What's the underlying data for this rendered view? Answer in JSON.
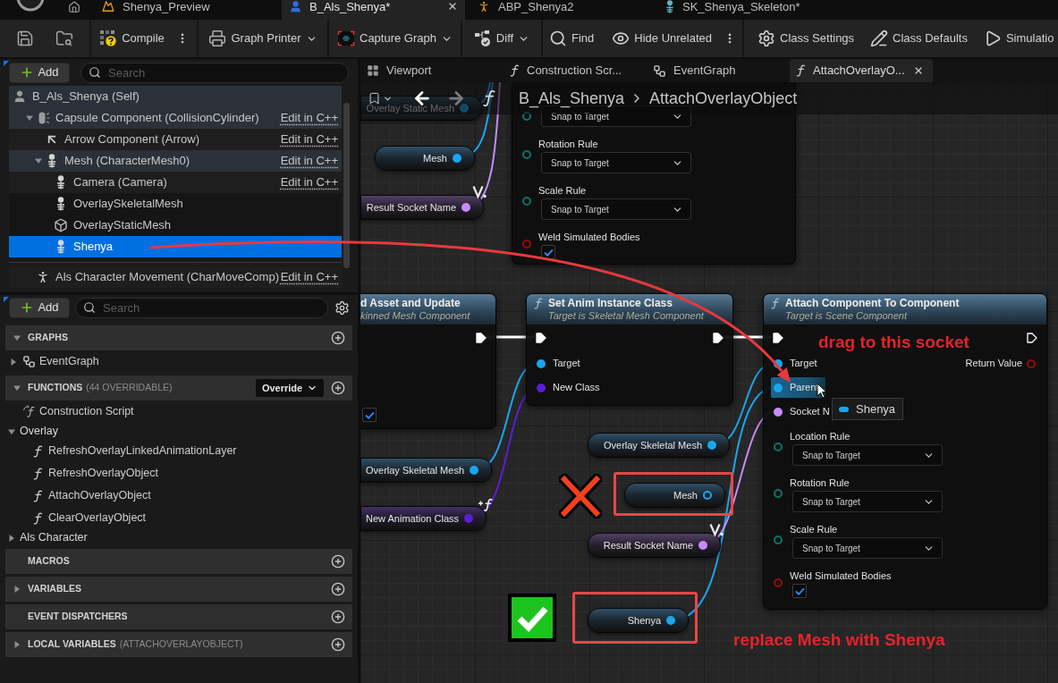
{
  "editor_tabs": [
    {
      "label": "Shenya_Preview",
      "kind": "preview",
      "selected": false
    },
    {
      "label": "B_Als_Shenya*",
      "kind": "blueprint",
      "selected": true
    },
    {
      "label": "ABP_Shenya2",
      "kind": "anim",
      "selected": false
    },
    {
      "label": "SK_Shenya_Skeleton*",
      "kind": "skeleton",
      "selected": false
    }
  ],
  "toolbar": [
    [
      {
        "kind": "save"
      },
      {
        "kind": "browse"
      }
    ],
    [
      {
        "kind": "compile",
        "label": "Compile",
        "dropdown": false,
        "more": true
      }
    ],
    [
      {
        "kind": "printer",
        "label": "Graph Printer",
        "dropdown": true,
        "more": false
      }
    ],
    [
      {
        "kind": "capture",
        "label": "Capture Graph",
        "dropdown": true,
        "more": false
      }
    ],
    [
      {
        "kind": "diff",
        "label": "Diff",
        "dropdown": true,
        "more": false
      }
    ],
    [
      {
        "kind": "find",
        "label": "Find",
        "dropdown": false,
        "more": false
      },
      {
        "kind": "hide",
        "label": "Hide Unrelated",
        "dropdown": false,
        "more": true
      }
    ],
    [
      {
        "kind": "settings",
        "label": "Class Settings",
        "dropdown": false,
        "more": false
      },
      {
        "kind": "defaults",
        "label": "Class Defaults",
        "dropdown": false,
        "more": false
      },
      {
        "kind": "simulation",
        "label": "Simulatio",
        "dropdown": false,
        "more": false
      }
    ]
  ],
  "components": {
    "add": "Add",
    "search_placeholder": "Search",
    "tree": [
      {
        "label": "B_Als_Shenya (Self)",
        "kind": "actor",
        "selected": false,
        "children": [
          {
            "label": "Capsule Component (CollisionCylinder)",
            "kind": "capsule",
            "edit_link": "Edit in C++",
            "expanded": true,
            "selected": false,
            "children": [
              {
                "label": "Arrow Component (Arrow)",
                "kind": "arrow",
                "edit_link": "Edit in C++",
                "selected": false
              },
              {
                "label": "Mesh (CharacterMesh0)",
                "kind": "skeletal",
                "edit_link": "Edit in C++",
                "expanded": true,
                "selected": false,
                "children": [
                  {
                    "label": "Camera (Camera)",
                    "kind": "skeletal",
                    "edit_link": "Edit in C++",
                    "selected": false
                  },
                  {
                    "label": "OverlaySkeletalMesh",
                    "kind": "skeletal",
                    "selected": false
                  },
                  {
                    "label": "OverlayStaticMesh",
                    "kind": "static",
                    "selected": false
                  },
                  {
                    "label": "Shenya",
                    "kind": "skeletal",
                    "selected": true
                  }
                ]
              }
            ]
          }
        ]
      }
    ],
    "movement": [
      {
        "label": "Als Character Movement (CharMoveComp)",
        "kind": "movement",
        "edit_link": "Edit in C++",
        "selected": false
      }
    ]
  },
  "my_blueprint": {
    "add": "Add",
    "search_placeholder": "Search",
    "sections": [
      {
        "title": "GRAPHS",
        "expanded": true,
        "items": [
          {
            "label": "EventGraph",
            "kind": "graph",
            "expanded": false
          }
        ]
      },
      {
        "title": "FUNCTIONS",
        "note": "(44 OVERRIDABLE)",
        "expanded": true,
        "override": "Override",
        "items": [
          {
            "label": "Construction Script",
            "kind": "construction"
          },
          {
            "label": "Overlay",
            "kind": "category",
            "expanded": true,
            "children": [
              {
                "label": "RefreshOverlayLinkedAnimationLayer",
                "kind": "function"
              },
              {
                "label": "RefreshOverlayObject",
                "kind": "function"
              },
              {
                "label": "AttachOverlayObject",
                "kind": "function"
              },
              {
                "label": "ClearOverlayObject",
                "kind": "function"
              }
            ]
          },
          {
            "label": "Als Character",
            "kind": "category",
            "expanded": false
          }
        ]
      },
      {
        "title": "MACROS"
      },
      {
        "title": "VARIABLES",
        "expanded": false
      },
      {
        "title": "EVENT DISPATCHERS"
      },
      {
        "title": "LOCAL VARIABLES",
        "note": "(ATTACHOVERLAYOBJECT)",
        "expanded": false
      }
    ]
  },
  "graph_tabs": [
    {
      "label": "Viewport",
      "kind": "viewport",
      "selected": false
    },
    {
      "label": "Construction Scr...",
      "kind": "function",
      "selected": false
    },
    {
      "label": "EventGraph",
      "kind": "graph",
      "selected": false
    },
    {
      "label": "AttachOverlayO...",
      "kind": "function",
      "selected": true
    }
  ],
  "graph": {
    "nav": {
      "back": {
        "disabled": false
      },
      "forward": {
        "disabled": true
      }
    },
    "breadcrumb": [
      "B_Als_Shenya",
      "AttachOverlayObject"
    ],
    "nodes": [
      {
        "pins": [
          {
            "kind": "enum",
            "value": "Snap to Target",
            "linked": false
          },
          {
            "kind": "enum",
            "label": "Rotation Rule",
            "value": "Snap to Target",
            "linked": false
          },
          {
            "kind": "enum",
            "label": "Scale Rule",
            "value": "Snap to Target",
            "linked": false
          },
          {
            "kind": "bool",
            "label": "Weld Simulated Bodies",
            "checked": true,
            "linked": false
          }
        ]
      },
      {
        "title": "d Asset and Update",
        "subtitle": "kinned Mesh Component",
        "exec": {
          "out": {
            "linked": true
          }
        },
        "pins": [
          {
            "kind": "bool",
            "checked": true
          }
        ]
      },
      {
        "title": "Set Anim Instance Class",
        "subtitle": "Target is Skeletal Mesh Component",
        "exec": {
          "in": {
            "linked": true
          },
          "out": {
            "linked": true
          }
        },
        "pins": [
          {
            "kind": "object",
            "label": "Target",
            "linked": true
          },
          {
            "kind": "class",
            "label": "New Class",
            "linked": true
          }
        ]
      },
      {
        "title": "Attach Component To Component",
        "subtitle": "Target is Scene Component",
        "exec": {
          "in": {
            "linked": true
          },
          "out": {
            "linked": false
          }
        },
        "pins": [
          {
            "kind": "object",
            "label": "Target",
            "linked": true,
            "hovered": false
          },
          {
            "kind": "object",
            "label": "Parent",
            "linked": true,
            "hovered": true
          },
          {
            "kind": "name",
            "label": "Socket N",
            "linked": true,
            "hovered": false
          },
          {
            "kind": "enum",
            "label": "Location Rule",
            "value": "Snap to Target",
            "linked": false
          },
          {
            "kind": "enum",
            "label": "Rotation Rule",
            "value": "Snap to Target",
            "linked": false
          },
          {
            "kind": "enum",
            "label": "Scale Rule",
            "value": "Snap to Target",
            "linked": false
          },
          {
            "kind": "bool",
            "label": "Weld Simulated Bodies",
            "checked": true,
            "linked": false
          }
        ],
        "outputs": [
          {
            "kind": "bool",
            "label": "Return Value",
            "linked": false
          }
        ]
      }
    ],
    "variables": [
      {
        "label": "Overlay Static Mesh",
        "kind": "object",
        "linked": true
      },
      {
        "label": "Mesh",
        "kind": "object",
        "linked": true
      },
      {
        "label": "Result Socket Name",
        "kind": "name",
        "linked": true,
        "badge": {
          "kind": "v_dot"
        }
      },
      {
        "label": "Overlay Skeletal Mesh",
        "kind": "object",
        "linked": true
      },
      {
        "label": "New Animation Class",
        "kind": "class",
        "linked": true,
        "badge": {
          "kind": "plus_function"
        }
      },
      {
        "label": "Overlay Skeletal Mesh",
        "kind": "object",
        "linked": true
      },
      {
        "label": "Mesh",
        "kind": "object",
        "linked": false
      },
      {
        "label": "Result Socket Name",
        "kind": "name",
        "linked": true,
        "badge": {
          "kind": "v_dot"
        }
      },
      {
        "label": "Shenya",
        "kind": "object",
        "linked": true
      }
    ],
    "tooltip": {
      "label": "Shenya"
    },
    "callouts": [
      "drag to this socket",
      "replace Mesh with Shenya"
    ]
  }
}
